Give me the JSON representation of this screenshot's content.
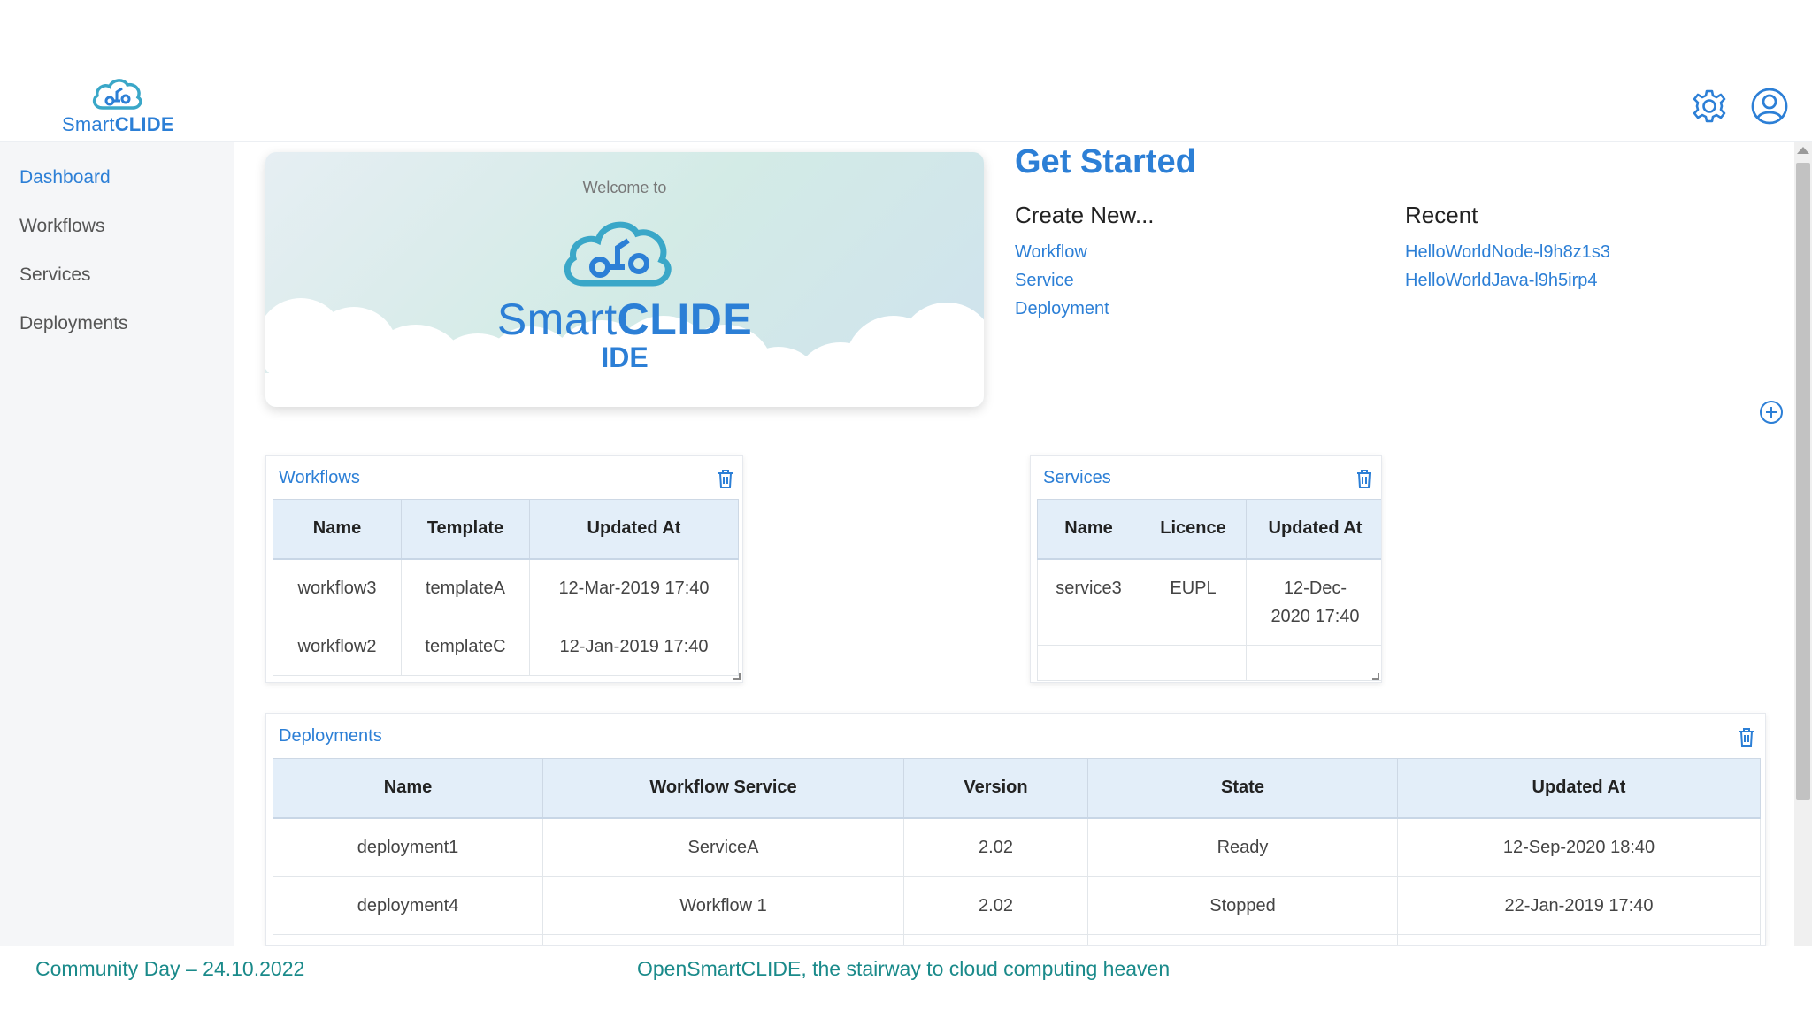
{
  "header": {
    "logo_text": "Smart",
    "logo_text_bold": "CLIDE",
    "settings_icon": "gear-icon",
    "user_icon": "user-circle-icon"
  },
  "sidebar": {
    "items": [
      {
        "label": "Dashboard",
        "active": true
      },
      {
        "label": "Workflows",
        "active": false
      },
      {
        "label": "Services",
        "active": false
      },
      {
        "label": "Deployments",
        "active": false
      }
    ]
  },
  "banner": {
    "welcome": "Welcome to",
    "brand_light": "Smart",
    "brand_bold": "CLIDE",
    "subtitle": "IDE"
  },
  "get_started": {
    "title": "Get Started",
    "create_heading": "Create New...",
    "create_links": [
      "Workflow",
      "Service",
      "Deployment"
    ],
    "recent_heading": "Recent",
    "recent_links": [
      "HelloWorldNode-l9h8z1s3",
      "HelloWorldJava-l9h5irp4"
    ]
  },
  "workflows": {
    "title": "Workflows",
    "columns": [
      "Name",
      "Template",
      "Updated At"
    ],
    "rows": [
      [
        "workflow3",
        "templateA",
        "12-Mar-2019 17:40"
      ],
      [
        "workflow2",
        "templateC",
        "12-Jan-2019 17:40"
      ]
    ]
  },
  "services": {
    "title": "Services",
    "columns": [
      "Name",
      "Licence",
      "Updated At"
    ],
    "rows": [
      [
        "service3",
        "EUPL",
        "12-Dec-2020 17:40"
      ]
    ]
  },
  "deployments": {
    "title": "Deployments",
    "columns": [
      "Name",
      "Workflow Service",
      "Version",
      "State",
      "Updated At"
    ],
    "rows": [
      [
        "deployment1",
        "ServiceA",
        "2.02",
        "Ready",
        "12-Sep-2020 18:40"
      ],
      [
        "deployment4",
        "Workflow 1",
        "2.02",
        "Stopped",
        "22-Jan-2019 17:40"
      ]
    ]
  },
  "footer": {
    "left": "Community Day – 24.10.2022",
    "center": "OpenSmartCLIDE, the stairway to cloud computing heaven"
  },
  "colors": {
    "accent": "#2c7fd6",
    "header_row": "#e3eef9",
    "footer_text": "#1a8a8a"
  }
}
